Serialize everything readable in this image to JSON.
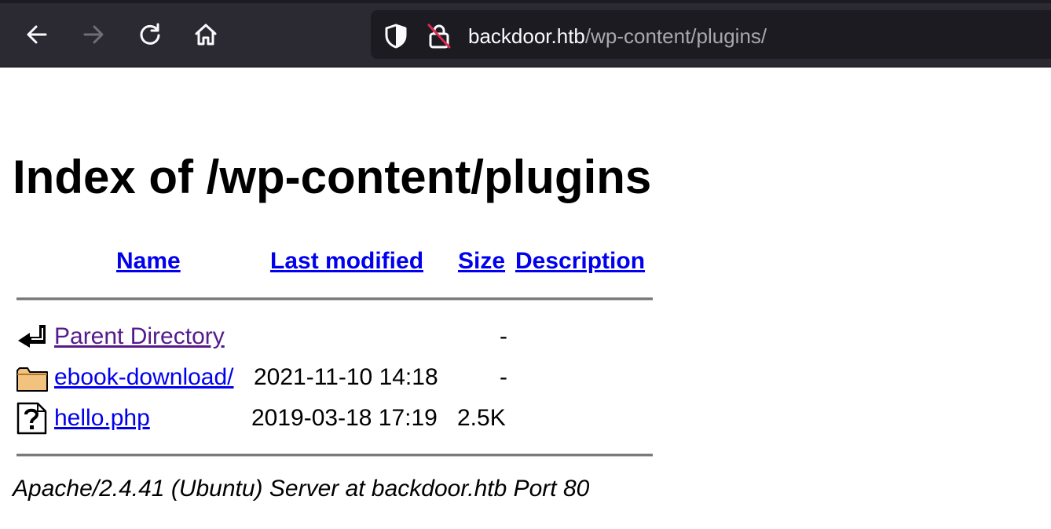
{
  "browser": {
    "url_host": "backdoor.htb",
    "url_path": "/wp-content/plugins/",
    "icons": {
      "back": "arrow-left-icon",
      "forward": "arrow-right-icon",
      "reload": "reload-icon",
      "home": "home-icon",
      "tracking": "shield-icon",
      "connection": "insecure-lock-icon"
    }
  },
  "page": {
    "title": "Index of /wp-content/plugins",
    "headers": {
      "name": "Name",
      "last_modified": "Last modified",
      "size": "Size",
      "description": "Description"
    },
    "rows": [
      {
        "icon": "back-arrow-icon",
        "name": "Parent Directory",
        "modified": "",
        "size": "-"
      },
      {
        "icon": "folder-icon",
        "name": "ebook-download/",
        "modified": "2021-11-10 14:18",
        "size": "-"
      },
      {
        "icon": "unknown-file-icon",
        "name": "hello.php",
        "modified": "2019-03-18 17:19",
        "size": "2.5K"
      }
    ],
    "address": "Apache/2.4.41 (Ubuntu) Server at backdoor.htb Port 80"
  }
}
